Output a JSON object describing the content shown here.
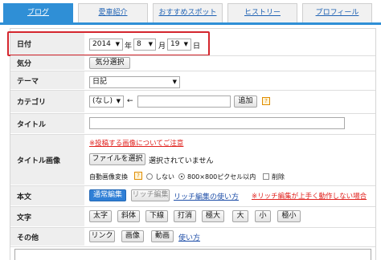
{
  "tabs": [
    {
      "label": "ブログ",
      "active": true
    },
    {
      "label": "愛車紹介"
    },
    {
      "label": "おすすめスポット"
    },
    {
      "label": "ヒストリー"
    },
    {
      "label": "プロフィール"
    }
  ],
  "form": {
    "date": {
      "label": "日付",
      "year": "2014",
      "year_unit": "年",
      "month": "8",
      "month_unit": "月",
      "day": "19",
      "day_unit": "日"
    },
    "mood": {
      "label": "気分",
      "button": "気分選択"
    },
    "theme": {
      "label": "テーマ",
      "value": "日記"
    },
    "category": {
      "label": "カテゴリ",
      "value": "(なし)",
      "arrow": "←",
      "add_button": "追加"
    },
    "title": {
      "label": "タイトル",
      "value": ""
    },
    "title_image": {
      "label": "タイトル画像",
      "notice": "※投稿する画像についてご注意",
      "file_button": "ファイルを選択",
      "file_status": "選択されていません",
      "auto_convert_label": "自動画像変換",
      "radio_none": "しない",
      "radio_800": "800×800ピクセル以内",
      "delete_label": "削除"
    },
    "body": {
      "label": "本文",
      "normal_edit": "通常編集",
      "rich_edit": "リッチ編集",
      "rich_howto": "リッチ編集の使い方",
      "rich_warning": "※リッチ編集が上手く動作しない場合"
    },
    "text": {
      "label": "文字",
      "buttons": [
        "太字",
        "斜体",
        "下線",
        "打消",
        "極大",
        "大",
        "小",
        "極小"
      ]
    },
    "other": {
      "label": "その他",
      "buttons": [
        "リンク",
        "画像",
        "動画"
      ],
      "howto": "使い方"
    }
  },
  "colors": {
    "accent": "#2f8fd6",
    "highlight": "#d4262e",
    "warning": "#e0201c",
    "link": "#1f4fa8"
  }
}
